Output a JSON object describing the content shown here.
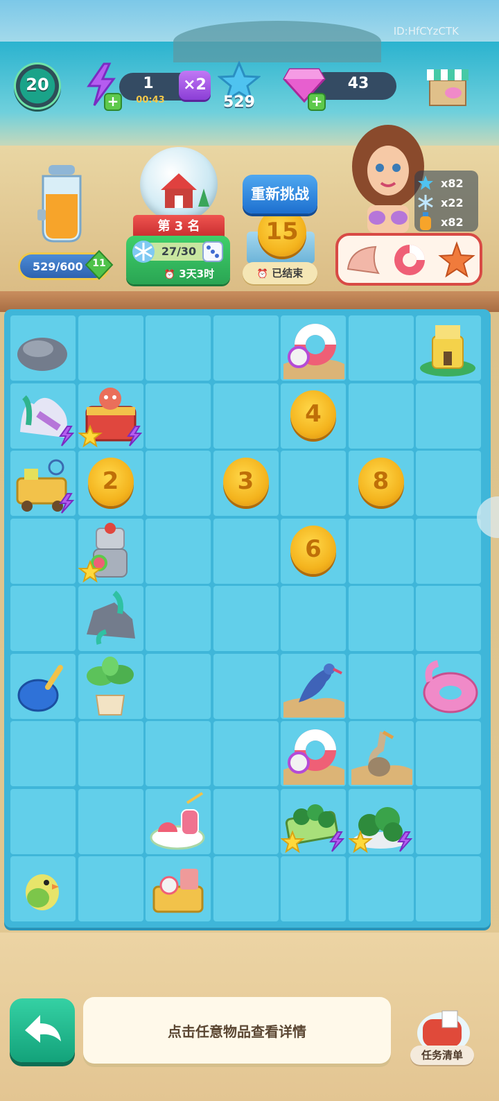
{
  "header": {
    "player_id": "ID:HfCYzCTK",
    "level": "20",
    "energy": "1",
    "energy_timer": "00:43",
    "multiplier": "×2",
    "stars": "529",
    "gems": "43"
  },
  "jar": {
    "progress_text": "529/600",
    "progress_fraction": 0.88,
    "level": "11"
  },
  "event": {
    "rank": "第 3 名",
    "progress_text": "27/30",
    "progress_fraction": 0.9,
    "timer": "3天3时"
  },
  "challenge": {
    "retry_label": "重新挑战",
    "coin_value": "15",
    "status": "已结束"
  },
  "rewards": [
    {
      "icon": "star-icon",
      "amount": "x82"
    },
    {
      "icon": "snowflake-icon",
      "amount": "x22"
    },
    {
      "icon": "bottle-icon",
      "amount": "x82"
    }
  ],
  "board": {
    "coins": [
      {
        "row": 1,
        "col": 4,
        "value": "4"
      },
      {
        "row": 2,
        "col": 1,
        "value": "2"
      },
      {
        "row": 2,
        "col": 3,
        "value": "3"
      },
      {
        "row": 2,
        "col": 5,
        "value": "8"
      },
      {
        "row": 3,
        "col": 4,
        "value": "6"
      }
    ]
  },
  "footer": {
    "info_text": "点击任意物品查看详情",
    "task_label": "任务清单"
  },
  "colors": {
    "board": "#3fb6d9",
    "cell": "#62cfea",
    "coin": "#f4b41e",
    "back_button": "#13a27a"
  }
}
